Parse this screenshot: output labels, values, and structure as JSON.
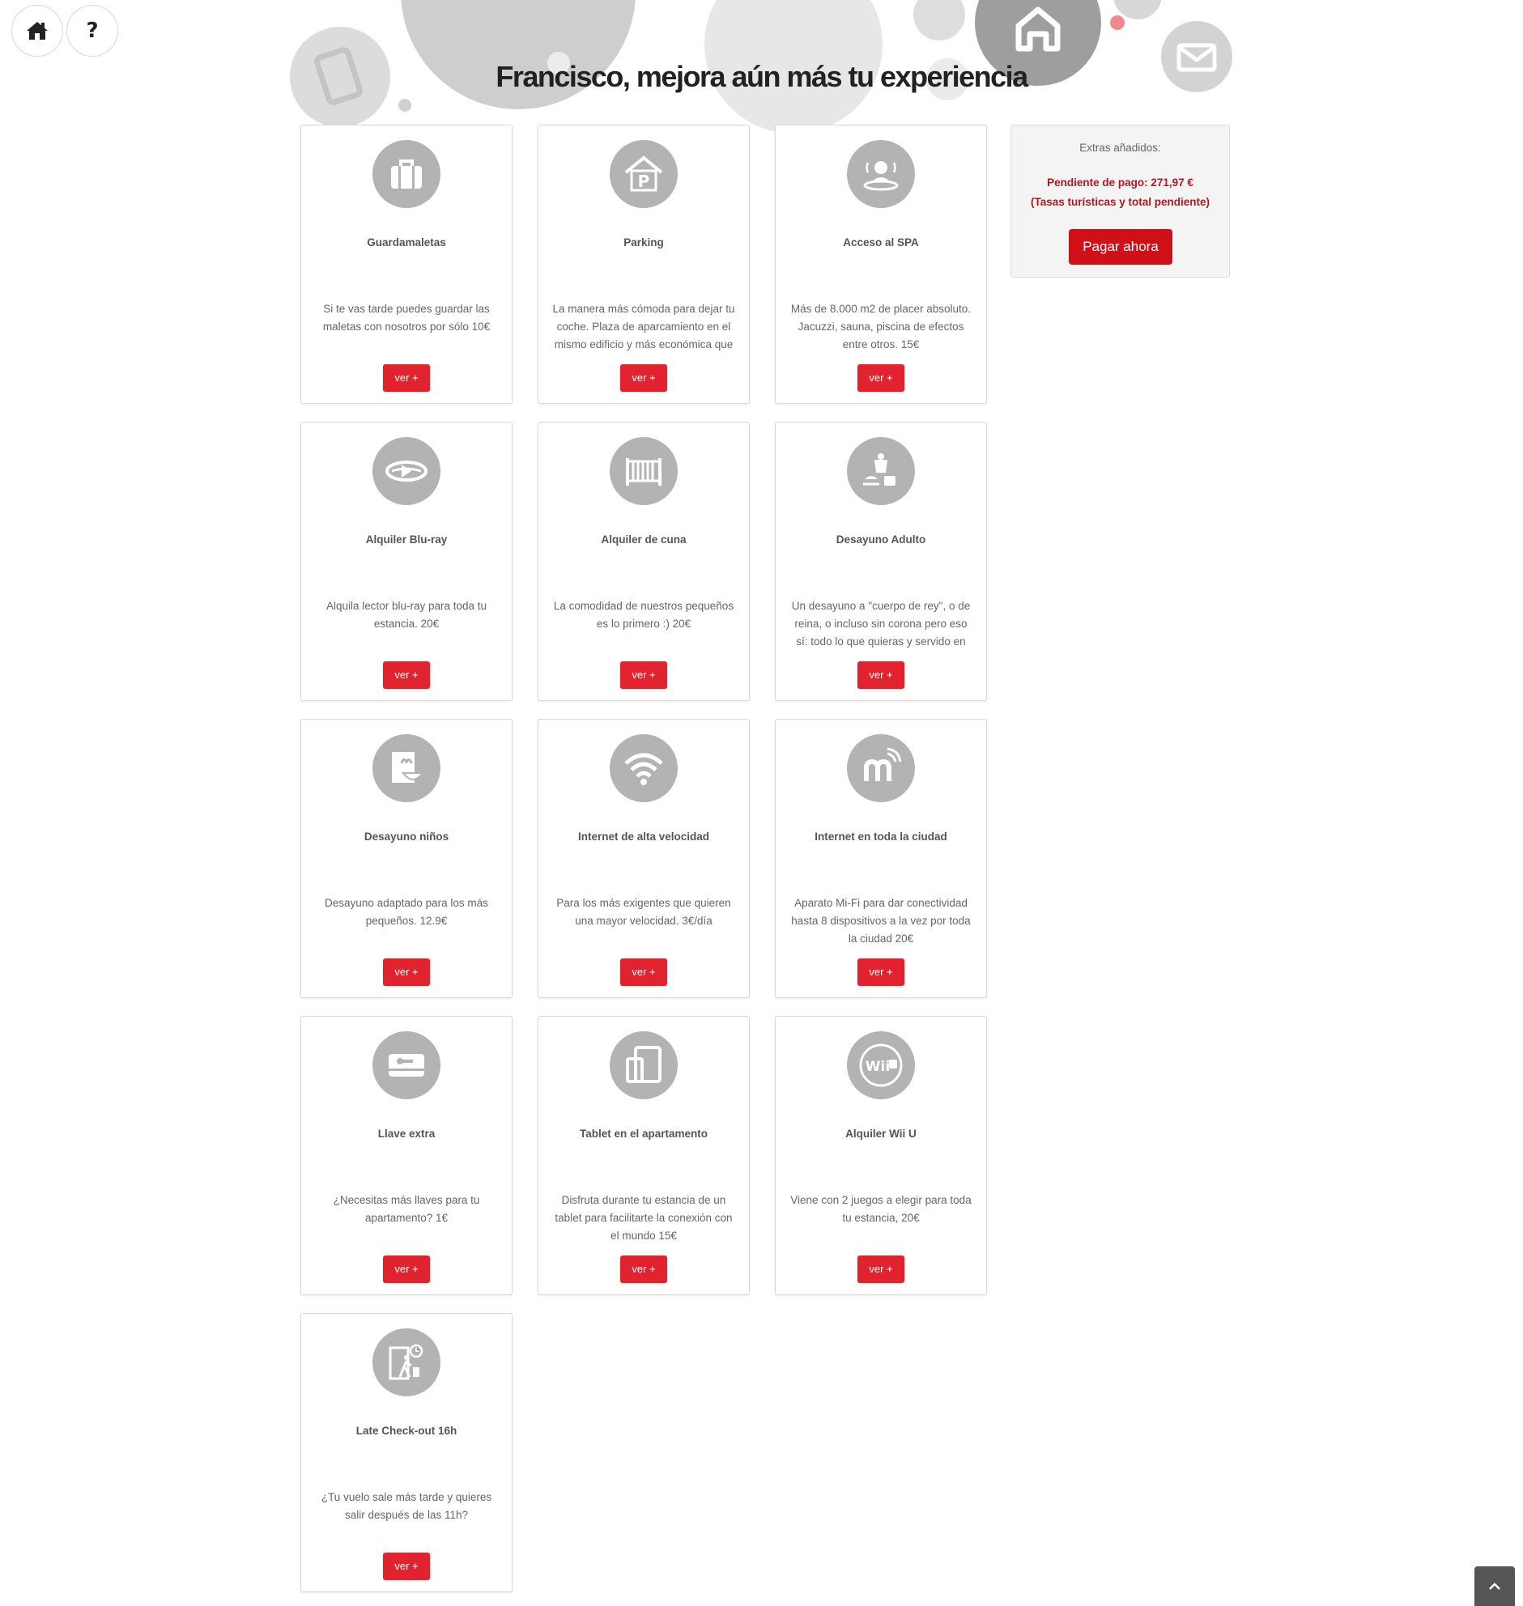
{
  "nav": {
    "home_icon": "home-icon",
    "help_label": "?"
  },
  "header": {
    "title": "Francisco, mejora aún más tu experiencia"
  },
  "summary": {
    "label": "Extras añadidos:",
    "pending": "Pendiente de pago: 271,97 €",
    "note": "(Tasas turísticas y total pendiente)",
    "pay_label": "Pagar ahora"
  },
  "cards": [
    {
      "title": "Guardamaletas",
      "icon": "luggage-icon",
      "desc": "Si te vas tarde puedes guardar las maletas con nosotros por sólo 10€",
      "button": "ver +"
    },
    {
      "title": "Parking",
      "icon": "parking-icon",
      "desc": "La manera más cómoda para dejar tu coche. Plaza de aparcamiento en el mismo edificio y más económica que",
      "button": "ver +"
    },
    {
      "title": "Acceso al SPA",
      "icon": "spa-icon",
      "desc": "Más de 8.000 m2 de placer absoluto. Jacuzzi, sauna, piscina de efectos entre otros. 15€",
      "button": "ver +"
    },
    {
      "title": "Alquiler Blu-ray",
      "icon": "bluray-icon",
      "desc": "Alquila lector blu-ray para toda tu estancia. 20€",
      "button": "ver +"
    },
    {
      "title": "Alquiler de cuna",
      "icon": "crib-icon",
      "desc": "La comodidad de nuestros pequeños es lo primero :) 20€",
      "button": "ver +"
    },
    {
      "title": "Desayuno Adulto",
      "icon": "breakfast-icon",
      "desc": "Un desayuno a \"cuerpo de rey\", o de reina, o incluso sin corona pero eso sí: todo lo que quieras y servido en mesa",
      "button": "ver +"
    },
    {
      "title": "Desayuno niños",
      "icon": "kids-breakfast-icon",
      "desc": "Desayuno adaptado para los más pequeños. 12.9€",
      "button": "ver +"
    },
    {
      "title": "Internet de alta velocidad",
      "icon": "wifi-icon",
      "desc": "Para los más exigentes que quieren una mayor velocidad. 3€/día",
      "button": "ver +"
    },
    {
      "title": "Internet en toda la ciudad",
      "icon": "mifi-icon",
      "desc": "Aparato Mi-Fi para dar conectividad hasta 8 dispositivos a la vez por toda la ciudad 20€",
      "button": "ver +"
    },
    {
      "title": "Llave extra",
      "icon": "key-card-icon",
      "desc": "¿Necesitas más llaves para tu apartamento? 1€",
      "button": "ver +"
    },
    {
      "title": "Tablet en el apartamento",
      "icon": "tablet-icon",
      "desc": "Disfruta durante tu estancia de un tablet para facilitarte la conexión con el mundo 15€",
      "button": "ver +"
    },
    {
      "title": "Alquiler Wii U",
      "icon": "wii-u-icon",
      "desc": "Viene con 2 juegos a elegir para toda tu estancia, 20€",
      "button": "ver +",
      "icon_text": "Wii"
    },
    {
      "title": "Late Check-out 16h",
      "icon": "late-checkout-icon",
      "desc": "¿Tu vuelo sale más tarde y quieres salir después de las 11h?",
      "button": "ver +"
    }
  ],
  "colors": {
    "accent": "#e0232e",
    "pay": "#cf1018",
    "pending_text": "#b01820",
    "icon_bg": "#b3b3b3"
  },
  "scroll_top_icon": "chevron-up-icon"
}
